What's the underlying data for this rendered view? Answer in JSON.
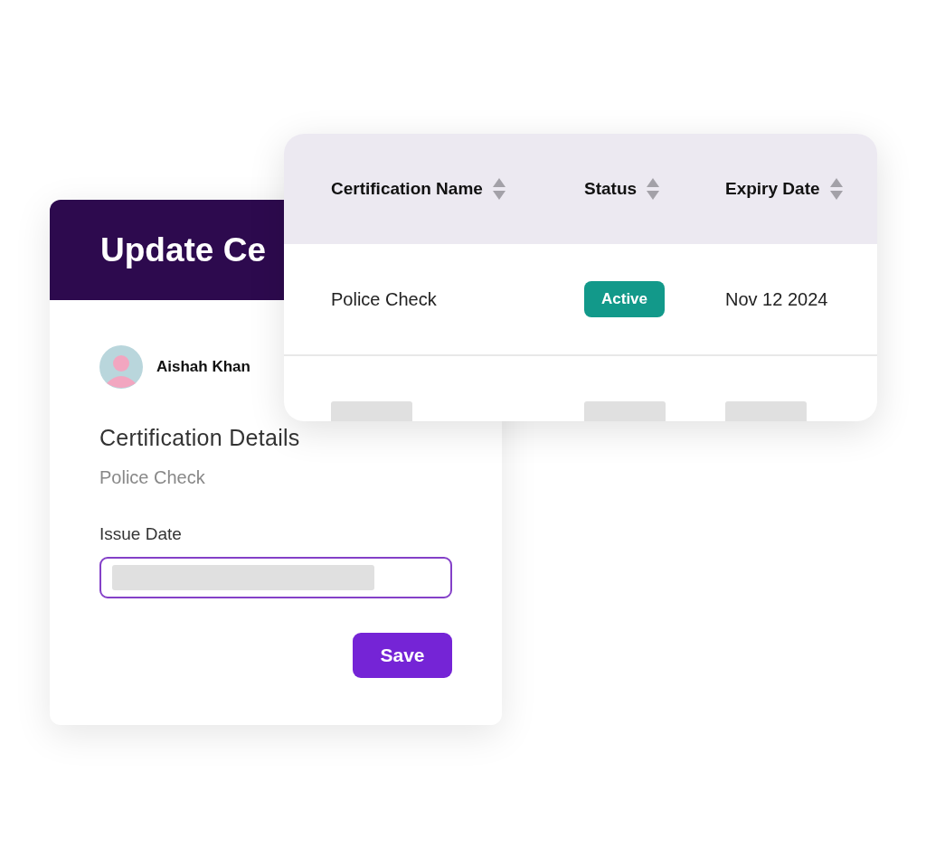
{
  "form_card": {
    "title": "Update Ce",
    "user": {
      "name": "Aishah Khan"
    },
    "section_title": "Certification Details",
    "certification": "Police Check",
    "field": {
      "label": "Issue Date"
    },
    "button": "Save"
  },
  "table": {
    "columns": [
      {
        "label": "Certification Name"
      },
      {
        "label": "Status"
      },
      {
        "label": "Expiry Date"
      }
    ],
    "rows": [
      {
        "kind": "data",
        "name": "Police Check",
        "status": {
          "label": "Active",
          "kind": "active"
        },
        "expiry": "Nov 12 2024"
      },
      {
        "kind": "skeleton"
      }
    ]
  }
}
